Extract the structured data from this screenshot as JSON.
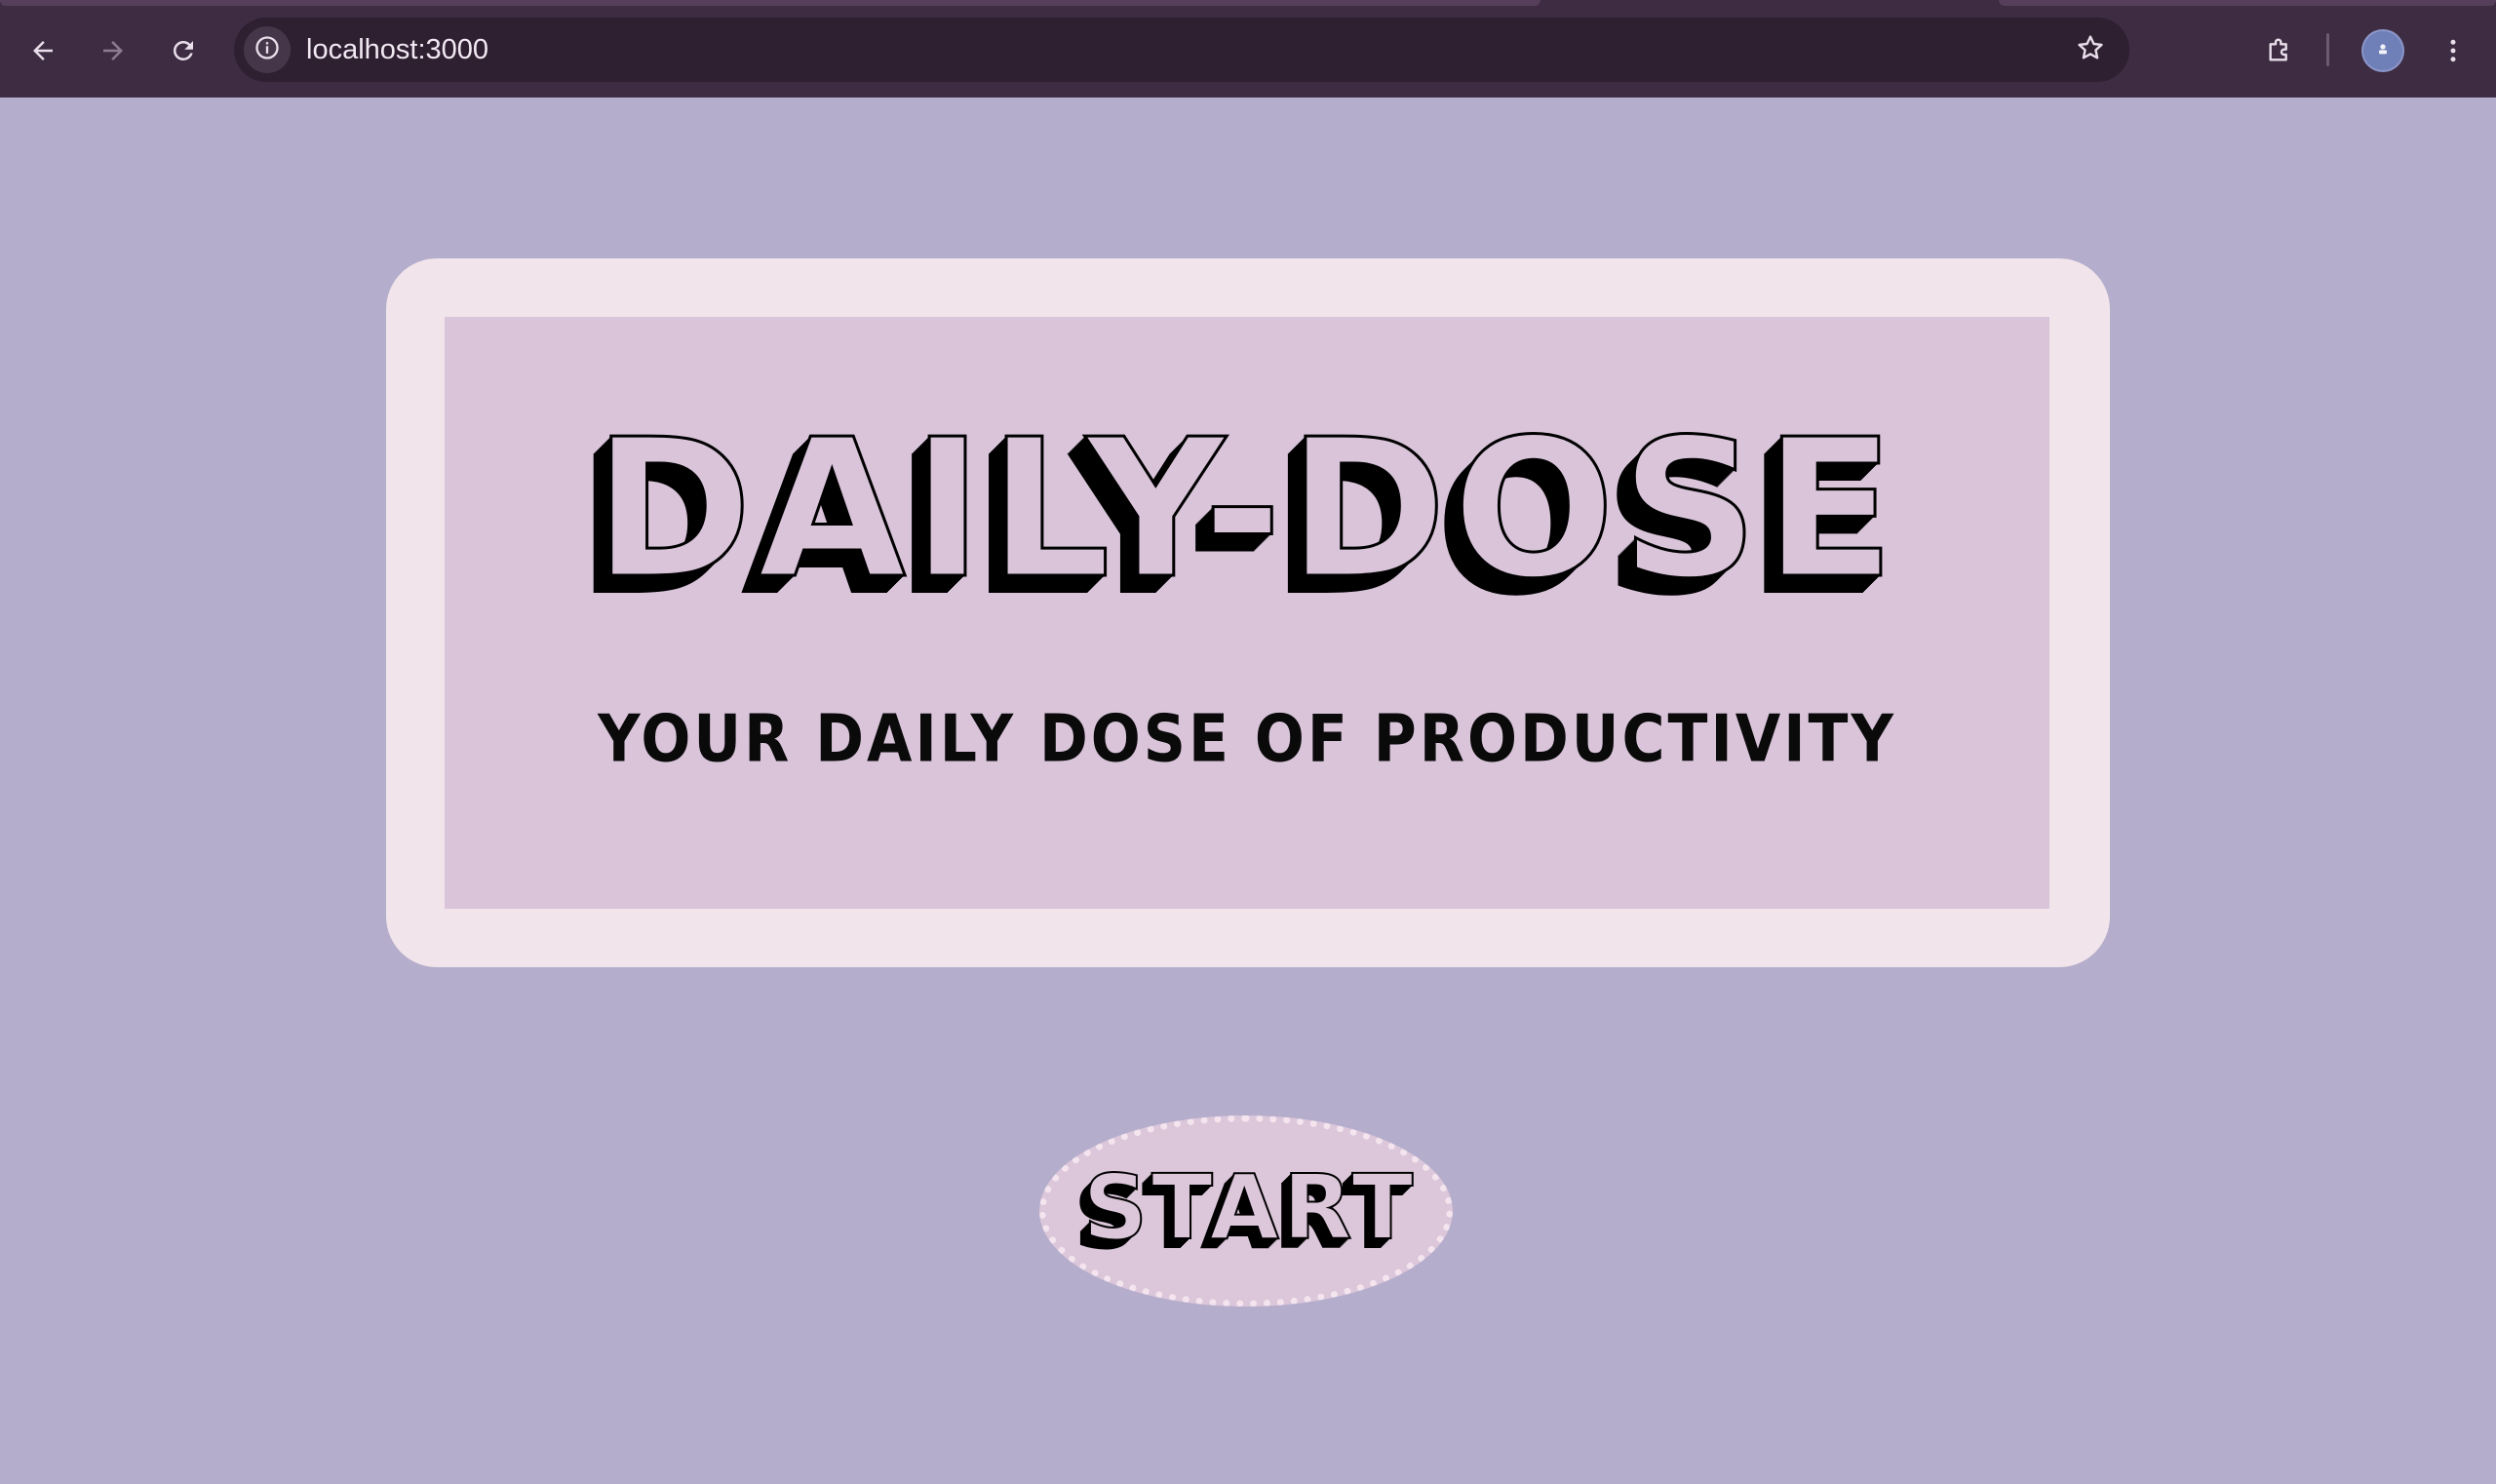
{
  "browser": {
    "url": "localhost:3000",
    "icons": {
      "back": "back-arrow-icon",
      "forward": "forward-arrow-icon",
      "reload": "reload-icon",
      "site_info": "site-info-icon",
      "bookmark": "star-icon",
      "extensions": "puzzle-piece-icon",
      "profile": "profile-avatar-icon",
      "menu": "kebab-menu-icon"
    },
    "colors": {
      "toolbar": "#3e2c42",
      "omnibox": "#2e1f31",
      "url_text": "#f1e9f2"
    }
  },
  "page": {
    "title": "DAILY-DOSE",
    "subtitle": "YOUR DAILY DOSE OF PRODUCTIVITY",
    "start_label": "START",
    "colors": {
      "background": "#b4adcc",
      "card_outer": "#f1e4ea",
      "card_inner": "#d9c4da",
      "text": "#000000"
    }
  }
}
